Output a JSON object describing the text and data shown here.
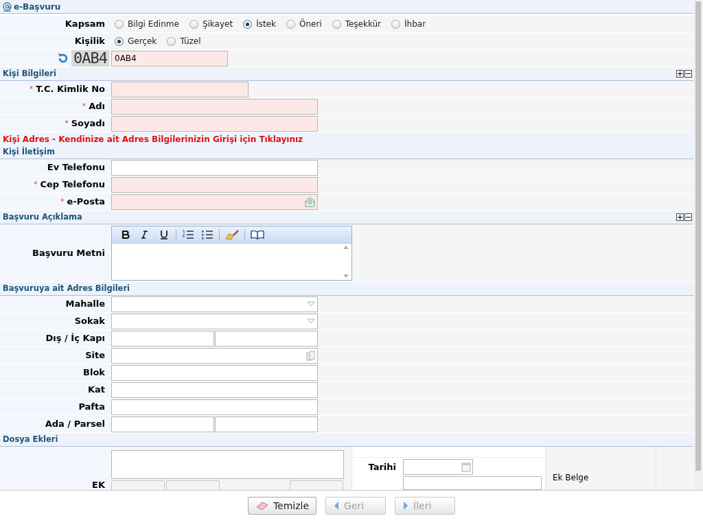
{
  "title": "e-Başvuru",
  "choice_rows": [
    {
      "label": "Kapsam",
      "options": [
        {
          "label": "Bilgi Edinme",
          "selected": false
        },
        {
          "label": "Şikayet",
          "selected": false
        },
        {
          "label": "İstek",
          "selected": true
        },
        {
          "label": "Öneri",
          "selected": false
        },
        {
          "label": "Teşekkür",
          "selected": false
        },
        {
          "label": "İhbar",
          "selected": false
        }
      ]
    },
    {
      "label": "Kişilik",
      "options": [
        {
          "label": "Gerçek",
          "selected": true
        },
        {
          "label": "Tüzel",
          "selected": false
        }
      ]
    }
  ],
  "captcha": {
    "code": "0AB4",
    "value": "0AB4"
  },
  "sections": [
    {
      "title": "Kişi Bilgileri",
      "collapsible": true,
      "rows": [
        {
          "label": "T.C. Kimlik No",
          "required_mark": "*",
          "fields": [
            {
              "kind": "short",
              "required": true
            }
          ]
        },
        {
          "label": "Adı",
          "required_mark": "*",
          "fields": [
            {
              "kind": "text",
              "required": true
            }
          ]
        },
        {
          "label": "Soyadı",
          "required_mark": "*",
          "fields": [
            {
              "kind": "text",
              "required": true
            }
          ]
        }
      ]
    },
    {
      "title": "Kişi Adres - Kendinize ait Adres Bilgilerinizin Girişi için Tıklayınız",
      "kind": "link"
    },
    {
      "title": "Kişi İletişim",
      "rows": [
        {
          "label": "Ev Telefonu",
          "fields": [
            {
              "kind": "text",
              "required": false
            }
          ]
        },
        {
          "label": "Cep Telefonu",
          "required_mark": "*",
          "fields": [
            {
              "kind": "text",
              "required": true
            }
          ]
        },
        {
          "label": "e-Posta",
          "required_mark": "*",
          "fields": [
            {
              "kind": "email",
              "required": true
            }
          ]
        }
      ]
    },
    {
      "title": "Başvuru Açıklama",
      "collapsible": true,
      "rows": [
        {
          "label": "Başvuru Metni",
          "fields": [
            {
              "kind": "editor"
            }
          ]
        }
      ]
    },
    {
      "title": "Başvuruya ait Adres Bilgileri",
      "rows": [
        {
          "label": "Mahalle",
          "fields": [
            {
              "kind": "select",
              "required": false
            }
          ]
        },
        {
          "label": "Sokak",
          "fields": [
            {
              "kind": "select",
              "required": false
            }
          ]
        },
        {
          "label": "Dış / İç Kapı",
          "fields": [
            {
              "kind": "half",
              "required": false
            },
            {
              "kind": "half",
              "required": false
            }
          ]
        },
        {
          "label": "Site",
          "fields": [
            {
              "kind": "lookup",
              "required": false
            }
          ]
        },
        {
          "label": "Blok",
          "fields": [
            {
              "kind": "text",
              "required": false
            }
          ]
        },
        {
          "label": "Kat",
          "fields": [
            {
              "kind": "text",
              "required": false
            }
          ]
        },
        {
          "label": "Pafta",
          "fields": [
            {
              "kind": "text",
              "required": false
            }
          ]
        },
        {
          "label": "Ada / Parsel",
          "fields": [
            {
              "kind": "half",
              "required": false
            },
            {
              "kind": "half",
              "required": false
            }
          ]
        }
      ]
    },
    {
      "title": "Dosya Ekleri",
      "kind": "attachments",
      "ek_label": "EK",
      "date_label": "Tarihi",
      "doc_label": "Ek Belge"
    }
  ],
  "buttons": [
    {
      "label": "Temizle",
      "kind": "clear",
      "disabled": false
    },
    {
      "label": "Geri",
      "kind": "back",
      "disabled": true
    },
    {
      "label": "İleri",
      "kind": "next",
      "disabled": true
    }
  ]
}
